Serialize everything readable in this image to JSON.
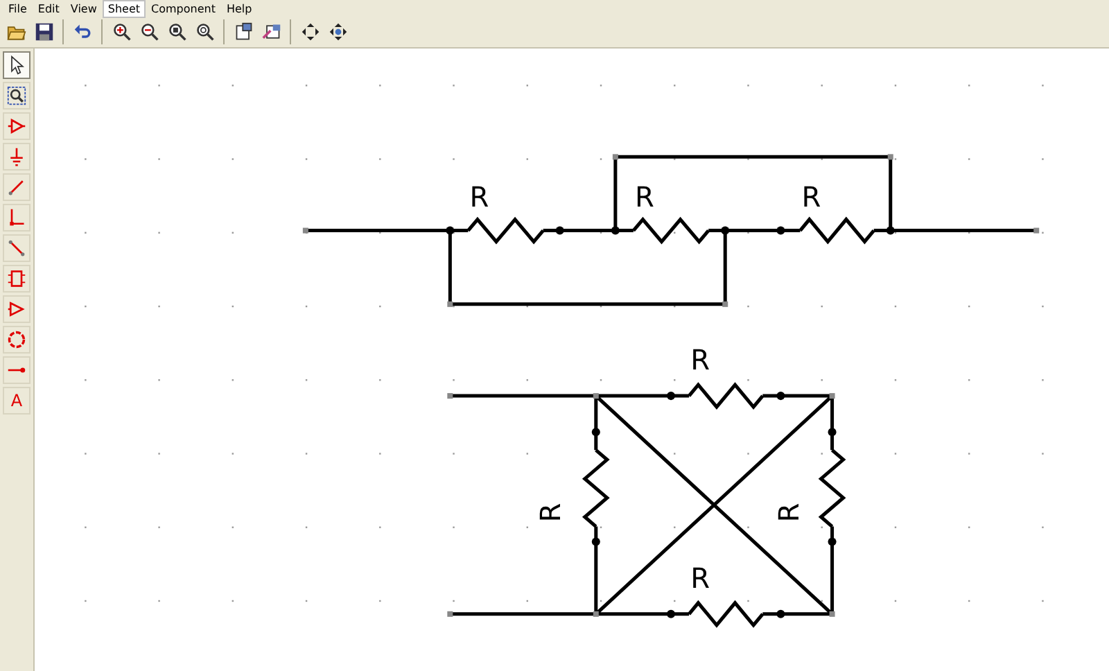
{
  "menu": [
    {
      "label": "File"
    },
    {
      "label": "Edit"
    },
    {
      "label": "View"
    },
    {
      "label": "Sheet",
      "selected": true
    },
    {
      "label": "Component"
    },
    {
      "label": "Help"
    }
  ],
  "toolbar": [
    {
      "kind": "open"
    },
    {
      "kind": "save"
    },
    {
      "kind": "sep"
    },
    {
      "kind": "undo"
    },
    {
      "kind": "sep"
    },
    {
      "kind": "zoom-in"
    },
    {
      "kind": "zoom-out"
    },
    {
      "kind": "zoom-fit"
    },
    {
      "kind": "zoom-page"
    },
    {
      "kind": "sep"
    },
    {
      "kind": "sheet"
    },
    {
      "kind": "sheet-arrow"
    },
    {
      "kind": "sep"
    },
    {
      "kind": "move"
    },
    {
      "kind": "move-center"
    }
  ],
  "tools": [
    {
      "kind": "pointer",
      "selected": true
    },
    {
      "kind": "zoom-select",
      "selected": false
    },
    {
      "kind": "amplifier",
      "selected": false
    },
    {
      "kind": "ground",
      "selected": false
    },
    {
      "kind": "wire",
      "selected": false
    },
    {
      "kind": "corner",
      "selected": false
    },
    {
      "kind": "diagonal",
      "selected": false
    },
    {
      "kind": "chip",
      "selected": false
    },
    {
      "kind": "triangle",
      "selected": false
    },
    {
      "kind": "circle",
      "selected": false
    },
    {
      "kind": "pin",
      "selected": false
    },
    {
      "kind": "text",
      "label": "A",
      "selected": false
    }
  ],
  "schematic": {
    "labels": [
      "R",
      "R",
      "R",
      "R",
      "R",
      "R",
      "R"
    ]
  }
}
